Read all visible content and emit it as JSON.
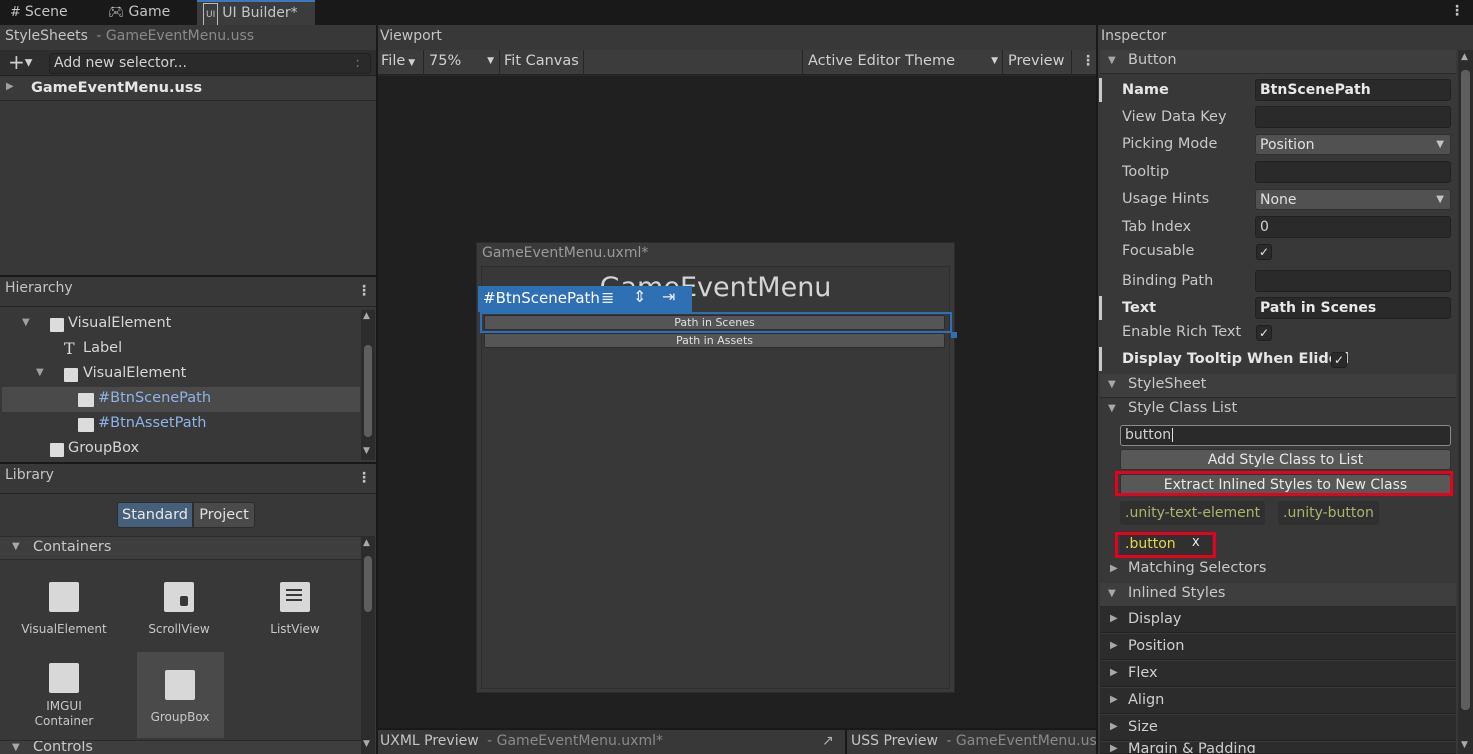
{
  "tabs": [
    {
      "label": "Scene",
      "icon": "#"
    },
    {
      "label": "Game",
      "icon": "gamepad-icon"
    },
    {
      "label": "UI Builder*",
      "icon": "ui-builder-icon"
    }
  ],
  "stylesheets": {
    "title": "StyleSheets",
    "subtitle": "- GameEventMenu.uss",
    "add_placeholder": "Add new selector...",
    "add_menu_glyph": ":",
    "file": "GameEventMenu.uss"
  },
  "hierarchy": {
    "title": "Hierarchy",
    "items": [
      {
        "label": "VisualElement",
        "type": "visual-element"
      },
      {
        "label": "Label",
        "type": "label"
      },
      {
        "label": "VisualElement",
        "type": "visual-element"
      },
      {
        "label": "#BtnScenePath",
        "type": "button"
      },
      {
        "label": "#BtnAssetPath",
        "type": "button"
      },
      {
        "label": "GroupBox",
        "type": "group-box"
      }
    ]
  },
  "library": {
    "title": "Library",
    "tabs": [
      "Standard",
      "Project"
    ],
    "section": "Containers",
    "items": [
      "VisualElement",
      "ScrollView",
      "ListView",
      "IMGUI Container",
      "GroupBox"
    ],
    "next_section": "Controls"
  },
  "viewport": {
    "title": "Viewport",
    "toolbar": {
      "file": "File",
      "zoom": "75%",
      "fit": "Fit Canvas",
      "theme": "Active Editor Theme",
      "preview": "Preview"
    },
    "canvas_title": "GameEventMenu.uxml*",
    "heading": "GameEventMenu",
    "selection_label": "#BtnScenePath",
    "buttons": [
      "Path in Scenes",
      "Path in Assets"
    ]
  },
  "bottom": {
    "uxml_title": "UXML Preview",
    "uxml_sub": "- GameEventMenu.uxml*",
    "uss_title": "USS Preview",
    "uss_sub": "- GameEventMenu.us"
  },
  "inspector": {
    "title": "Inspector",
    "button_section": "Button",
    "fields": {
      "name_label": "Name",
      "name_value": "BtnScenePath",
      "viewdata_label": "View Data Key",
      "viewdata_value": "",
      "picking_label": "Picking Mode",
      "picking_value": "Position",
      "tooltip_label": "Tooltip",
      "tooltip_value": "",
      "usage_label": "Usage Hints",
      "usage_value": "None",
      "tabindex_label": "Tab Index",
      "tabindex_value": "0",
      "focusable_label": "Focusable",
      "focusable_checked": true,
      "binding_label": "Binding Path",
      "binding_value": "",
      "text_label": "Text",
      "text_value": "Path in Scenes",
      "richtext_label": "Enable Rich Text",
      "richtext_checked": true,
      "elided_label": "Display Tooltip When Elided",
      "elided_checked": true
    },
    "stylesheet_section": "StyleSheet",
    "style_class_list": "Style Class List",
    "class_input": "button",
    "add_class_button": "Add Style Class to List",
    "extract_button": "Extract Inlined Styles to New Class",
    "classes": [
      ".unity-text-element",
      ".unity-button"
    ],
    "user_class": ".button",
    "user_class_remove": "X",
    "matching_selectors": "Matching Selectors",
    "inlined_styles": "Inlined Styles",
    "style_groups": [
      "Display",
      "Position",
      "Flex",
      "Align",
      "Size",
      "Margin & Padding"
    ]
  },
  "colors": {
    "accent": "#3a79bb",
    "selection_blue": "#2f6fb3",
    "highlight_red": "#e8001c",
    "class_green": "#a5b86a",
    "class_yellow": "#e8d44d"
  }
}
